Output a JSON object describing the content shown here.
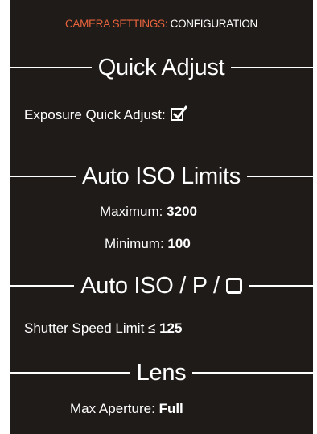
{
  "header": {
    "crumb_accent": "CAMERA SETTINGS:",
    "crumb_main": "CONFIGURATION",
    "accent_color": "#e8643c"
  },
  "sections": {
    "quick_adjust": {
      "title": "Quick Adjust",
      "exposure_label": "Exposure Quick Adjust:",
      "exposure_checked": true,
      "exposure_icon": "checked-checkbox-icon"
    },
    "auto_iso_limits": {
      "title": "Auto ISO Limits",
      "maximum_label": "Maximum:",
      "maximum_value": "3200",
      "minimum_label": "Minimum:",
      "minimum_value": "100"
    },
    "auto_iso_p": {
      "title": "Auto ISO / P /",
      "title_icon": "square-icon",
      "shutter_label": "Shutter Speed Limit ≤",
      "shutter_value": "125"
    },
    "lens": {
      "title": "Lens",
      "aperture_label": "Max Aperture:",
      "aperture_value": "Full"
    }
  },
  "colors": {
    "background": "#1f1b19",
    "text": "#ffffff"
  }
}
